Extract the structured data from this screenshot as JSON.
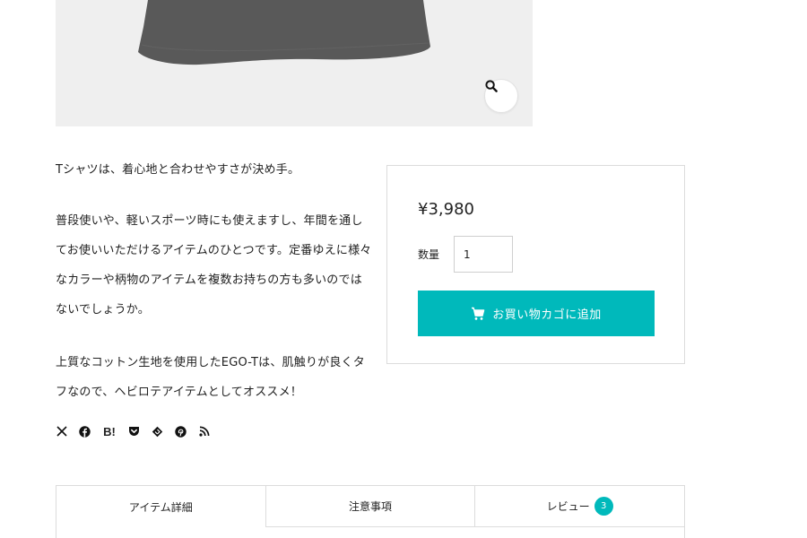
{
  "product_image": {
    "background_color": "#efefef",
    "shirt_color": "#595959",
    "zoom_icon": "magnifier-icon"
  },
  "description": {
    "paragraphs": [
      "Tシャツは、着心地と合わせやすさが決め手。",
      "普段使いや、軽いスポーツ時にも使えますし、年間を通してお使いいただけるアイテムのひとつです。定番ゆえに様々なカラーや柄物のアイテムを複数お持ちの方も多いのではないでしょうか。",
      "上質なコットン生地を使用したEGO-Tは、肌触りが良くタフなので、ヘビロテアイテムとしてオススメ！"
    ]
  },
  "share": {
    "icons": [
      "x-icon",
      "facebook-icon",
      "hatena-bookmark-icon",
      "pocket-icon",
      "feedly-icon",
      "pinterest-icon",
      "rss-icon"
    ],
    "hatena_label": "B!"
  },
  "purchase": {
    "price": "¥3,980",
    "quantity_label": "数量",
    "quantity_value": "1",
    "add_to_cart_label": "お買い物カゴに追加",
    "accent_color": "#00b9bb"
  },
  "tabs": {
    "items": [
      {
        "label": "アイテム詳細",
        "active": true
      },
      {
        "label": "注意事項",
        "active": false
      },
      {
        "label": "レビュー",
        "active": false,
        "badge": "3"
      }
    ]
  }
}
